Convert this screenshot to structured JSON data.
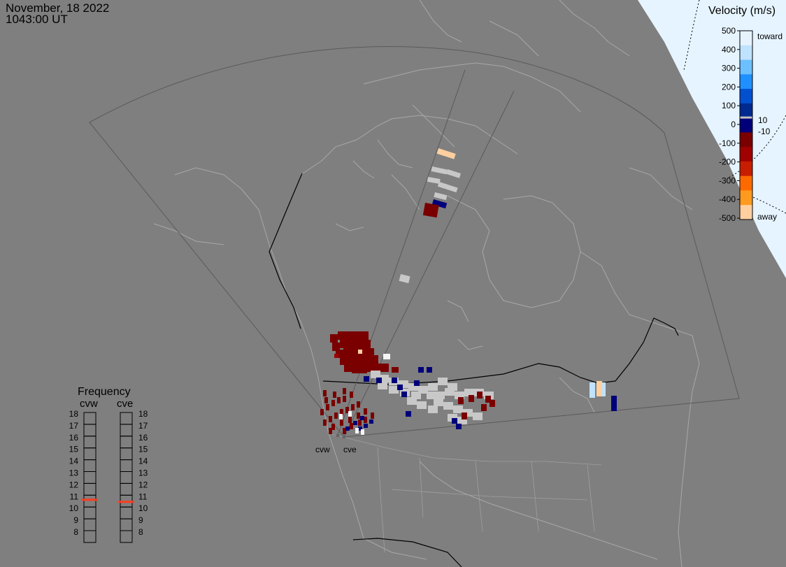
{
  "header": {
    "date": "November, 18 2022",
    "time": "1043:00 UT"
  },
  "velocity_scale": {
    "title": "Velocity (m/s)",
    "ticks": [
      "500",
      "400",
      "300",
      "200",
      "100",
      "0",
      "-100",
      "-200",
      "-300",
      "-400",
      "-500"
    ],
    "inner_labels": [
      "10",
      "-10"
    ],
    "toward_label": "toward",
    "away_label": "away",
    "colors": [
      "#e6f3ff",
      "#bfe2ff",
      "#6cc0ff",
      "#1f90ff",
      "#0050d0",
      "#002a90",
      "#00007a",
      "#7a0000",
      "#a00000",
      "#c81e00",
      "#ff6a00",
      "#ff9a20",
      "#ffcfa0"
    ]
  },
  "frequency": {
    "title": "Frequency",
    "radars": [
      {
        "name": "cvw",
        "selected": "11"
      },
      {
        "name": "cve",
        "selected": "11"
      }
    ],
    "levels": [
      "18",
      "17",
      "16",
      "15",
      "14",
      "13",
      "12",
      "11",
      "10",
      "9",
      "8"
    ],
    "marker_color": "#ff3c1e"
  },
  "sites": [
    {
      "name": "cvw"
    },
    {
      "name": "cve"
    }
  ],
  "colors": {
    "background": "#7f7f7f",
    "coastline": "#a8a8a8",
    "border": "#000000",
    "fov": "#5a5a5a",
    "ground_scatter": "#c8c8c8",
    "sunlit": "#e6f4ff"
  }
}
